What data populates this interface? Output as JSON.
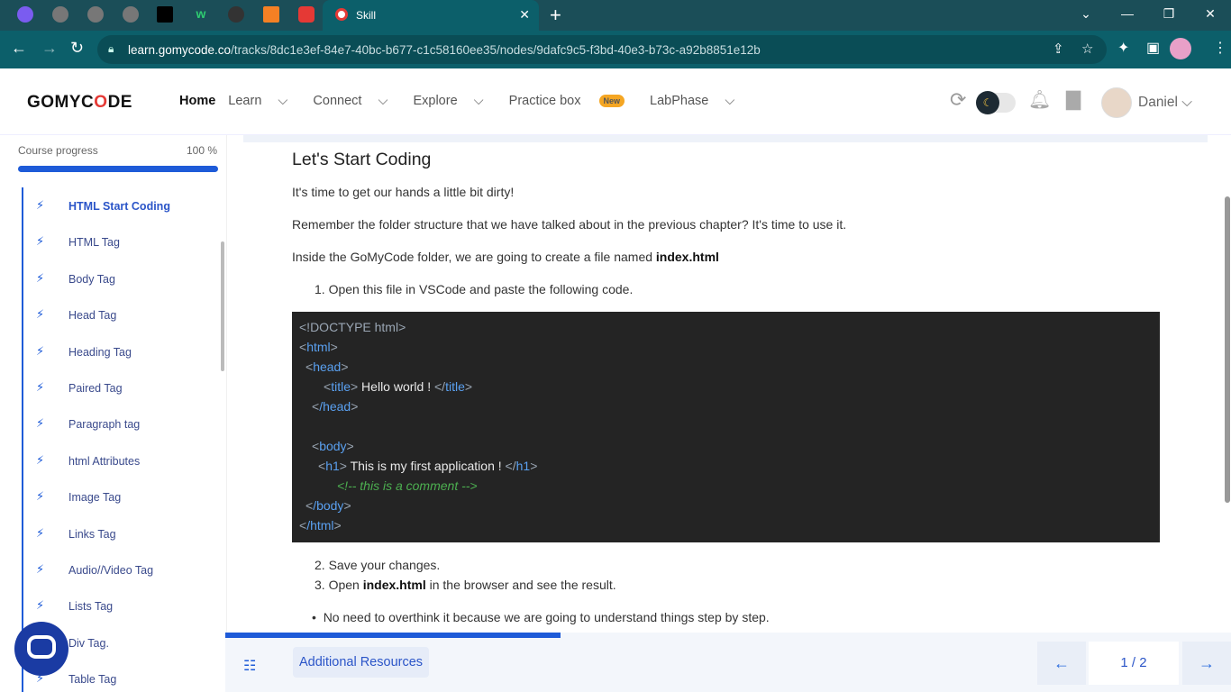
{
  "browser": {
    "tab_title": "Skill",
    "tab_close": "✕",
    "new_tab": "+",
    "win_min": "⌄",
    "win_minimize": "—",
    "win_restore": "❐",
    "win_close": "✕",
    "url_host": "learn.gomycode.co",
    "url_path": "/tracks/8dc1e3ef-84e7-40bc-b677-c1c58160ee35/nodes/9dafc9c5-f3bd-40e3-b73c-a92b8851e12b"
  },
  "header": {
    "logo_a": "GOMYC",
    "logo_b": "O",
    "logo_c": "DE",
    "nav": {
      "home": "Home",
      "learn": "Learn",
      "connect": "Connect",
      "explore": "Explore",
      "practice": "Practice box",
      "new_badge": "New",
      "labphase": "LabPhase"
    },
    "user_name": "Daniel"
  },
  "sidebar": {
    "progress_label": "Course progress",
    "progress_value": "100 %",
    "progress_fraction": 1.0,
    "lessons": [
      "HTML Start Coding",
      "HTML Tag",
      "Body Tag",
      "Head Tag",
      "Heading Tag",
      "Paired Tag",
      "Paragraph tag",
      "html Attributes",
      "Image Tag",
      "Links Tag",
      "Audio//Video Tag",
      "Lists Tag",
      "Div Tag.",
      "Table Tag"
    ]
  },
  "content": {
    "title": "Let's Start Coding",
    "p1": "It's time to get our hands a little bit dirty!",
    "p2": "Remember the folder structure that we have talked about in the previous chapter? It's time to use it.",
    "p3_pre": "Inside the GoMyCode folder, we are going to create a file named ",
    "p3_bold": "index.html",
    "step1": "1. Open this file in VSCode and paste the following code.",
    "code": {
      "doctype": "<!DOCTYPE html>",
      "html_open": "html",
      "head_open": "head",
      "title_tag": "title",
      "title_text": " Hello world ! ",
      "head_close": "/head",
      "body_open": "body",
      "h1_tag": "h1",
      "h1_text": " This is my first application ! ",
      "comment": "<!-- this is a comment -->",
      "body_close": "/body",
      "html_close": "/html"
    },
    "step2": "2. Save your changes.",
    "step3_pre": "3. Open ",
    "step3_bold": "index.html",
    "step3_post": " in the browser and see the result.",
    "bullet1": "No need to overthink it because we are going to understand things step by step."
  },
  "footer": {
    "resources": "Additional Resources",
    "page": "1 / 2",
    "progress_fraction": 0.333,
    "prev_icon": "arrow-left-icon",
    "next_icon": "arrow-right-icon"
  },
  "colors": {
    "accent": "#1e5bd8",
    "browser": "#0c5f6a",
    "code_bg": "#242424"
  }
}
